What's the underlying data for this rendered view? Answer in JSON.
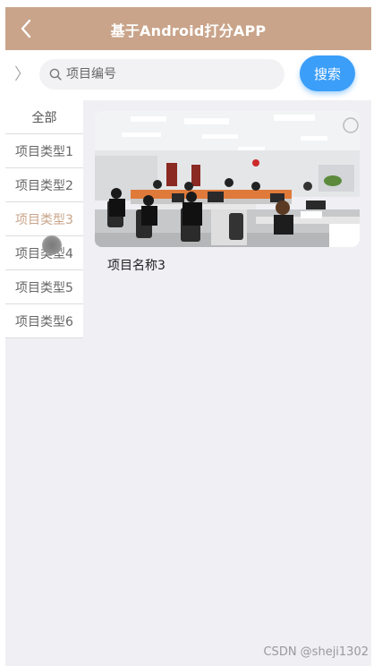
{
  "header": {
    "title": "基于Android打分APP",
    "back_icon": "chevron-left-icon"
  },
  "search": {
    "placeholder": "项目编号",
    "button_label": "搜索",
    "toggle_glyph": "〉"
  },
  "sidebar": {
    "items": [
      {
        "label": "全部"
      },
      {
        "label": "项目类型1"
      },
      {
        "label": "项目类型2"
      },
      {
        "label": "项目类型3",
        "active": true
      },
      {
        "label": "项目类型4"
      },
      {
        "label": "项目类型5"
      },
      {
        "label": "项目类型6"
      }
    ]
  },
  "projects": [
    {
      "name": "项目名称3"
    }
  ],
  "watermark": "CSDN @sheji1302",
  "colors": {
    "header_bg": "#c9a48a",
    "accent_blue": "#3b9ef8",
    "active_category": "#c9a48a"
  }
}
